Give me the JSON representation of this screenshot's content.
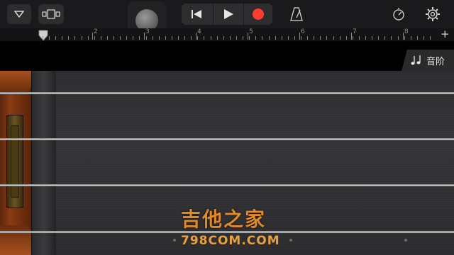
{
  "toolbar": {
    "buttons": [
      "dropdown-triangle",
      "browser-view",
      "record-knob",
      "go-to-start",
      "play",
      "record",
      "metronome",
      "tempo-settings",
      "settings"
    ]
  },
  "ruler": {
    "labels": [
      "2",
      "3",
      "4",
      "5",
      "6",
      "7",
      "8"
    ],
    "add_label": "+"
  },
  "scale_button": {
    "icon": "music-notes-icon",
    "label": "音阶"
  },
  "watermark": {
    "chinese": "吉他之家",
    "url": "798COM.COM"
  },
  "colors": {
    "record_red": "#ff3b30",
    "watermark_orange": "#e0882a",
    "wood": "#8a3a14"
  }
}
